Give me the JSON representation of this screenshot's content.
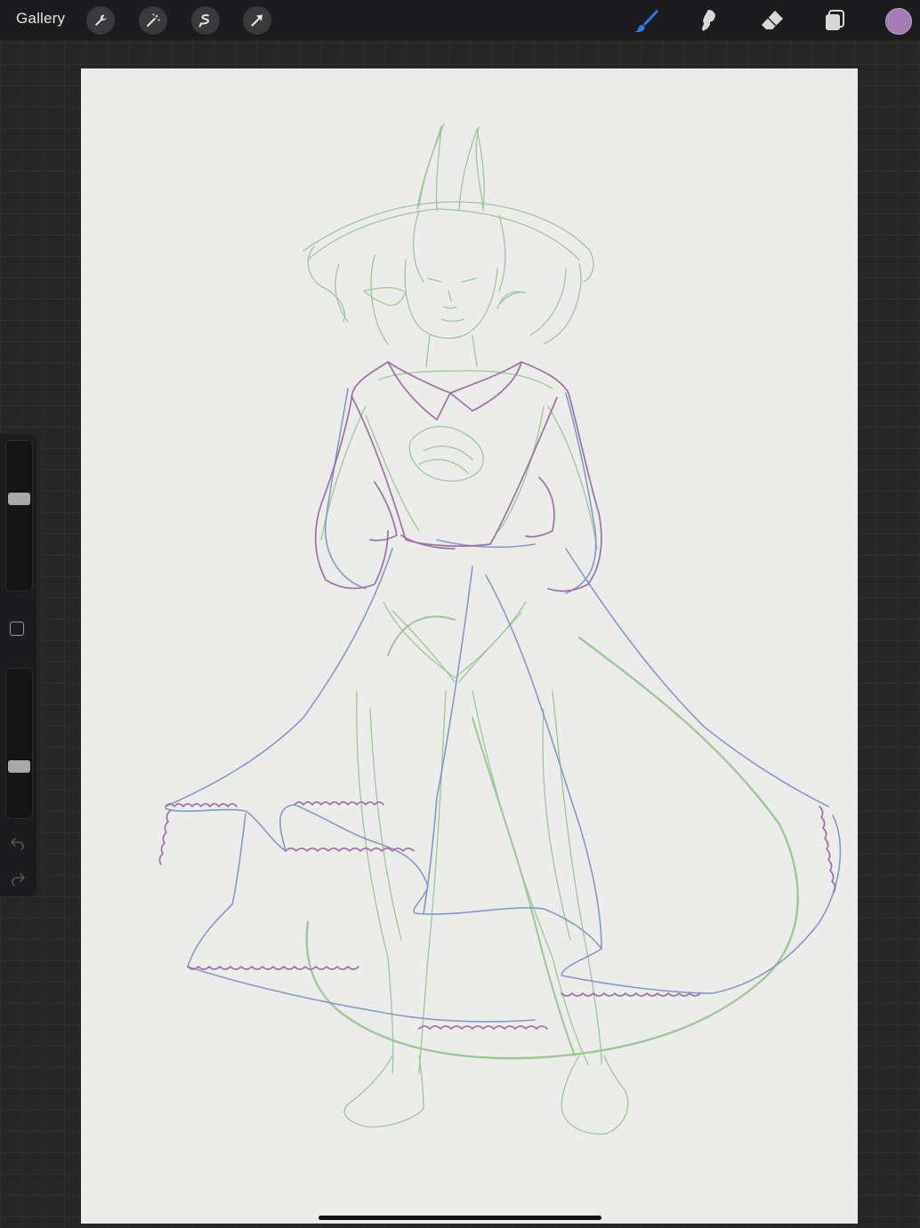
{
  "toolbar": {
    "gallery_label": "Gallery",
    "left_tools": [
      "wrench-icon",
      "magic-wand-icon",
      "selection-icon",
      "transform-arrow-icon"
    ],
    "right_tools": [
      "brush-icon",
      "smudge-icon",
      "eraser-icon",
      "layers-icon"
    ],
    "active_tool": "brush",
    "active_tool_color": "#2f7bf6",
    "current_color": "#a77ab8"
  },
  "sidebar": {
    "brush_size_level": 0.63,
    "opacity_level": 0.32,
    "undo_icon": "undo-icon",
    "redo_icon": "redo-icon"
  },
  "canvas": {
    "background": "#ececea",
    "stroke_colors": {
      "green": "#93c48c",
      "blue": "#7b96c8",
      "purple": "#9b6a9f"
    }
  }
}
